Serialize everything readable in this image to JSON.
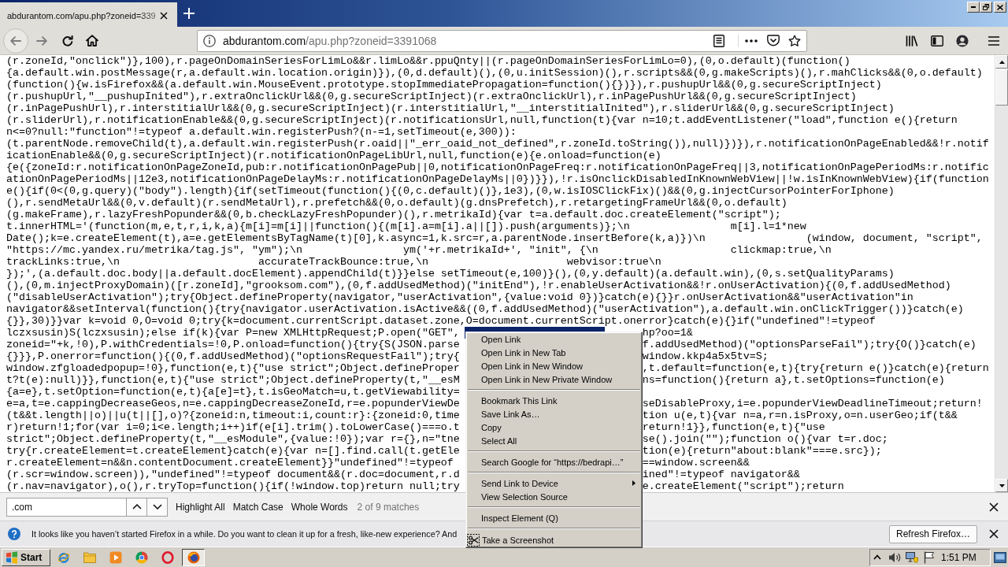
{
  "tab": {
    "title": "abdurantom.com/apu.php?zoneid=339",
    "selected": true
  },
  "back_button": {
    "disabled": true
  },
  "forward_button": {
    "disabled": true
  },
  "address_bar": {
    "domain": "abdurantom.com",
    "path": "/apu.php?zoneid=3391068"
  },
  "code_lines": [
    {
      "text": "(r.zoneId,\"onclick\")},100),r.pageOnDomainSeriesForLimLo&&r.limLo&&r.ppuQnty||(r.pageOnDomainSeriesForLimLo=0),(0,o.default)(function()"
    },
    {
      "text": "{a.default.win.postMessage(r,a.default.win.location.origin)}),(0,d.default)(),(0,u.initSession)(),r.scripts&&(0,g.makeScripts)(),r.mahClicks&&(0,o.default)"
    },
    {
      "text": "(function(){w.isFirefox&&(a.default.win.MouseEvent.prototype.stopImmediatePropagation=function(){})}),r.pushupUrl&&(0,g.secureScriptInject)"
    },
    {
      "text": "(r.pushupUrl,\"__pushupInited\"),r.extraOnclickUrl&&(0,g.secureScriptInject)(r.extraOnclickUrl),r.inPagePushUrl&&(0,g.secureScriptInject)"
    },
    {
      "text": "(r.inPagePushUrl),r.interstitialUrl&&(0,g.secureScriptInject)(r.interstitialUrl,\"__interstitialInited\"),r.sliderUrl&&(0,g.secureScriptInject)"
    },
    {
      "text": "(r.sliderUrl),r.notificationEnable&&(0,g.secureScriptInject)(r.notificationsUrl,null,function(t){var n=10;t.addEventListener(\"load\",function e(){return"
    },
    {
      "text": "n<=0?null:\"function\"!=typeof a.default.win.registerPush?(n-=1,setTimeout(e,300)):"
    },
    {
      "text": "(t.parentNode.removeChild(t),a.default.win.registerPush(r.oaid||\"_err_oaid_not_defined\",r.zoneId.toString()),null)})}),r.notificationOnPageEnabled&&!r.notif"
    },
    {
      "text": "icationEnable&&(0,g.secureScriptInject)(r.notificationOnPageLibUrl,null,function(e){e.onload=function(e)"
    },
    {
      "text": "{e({zoneId:r.notificationOnPageZoneId,pub:r.notificationOnPagePub||0,notificationOnPageFreq:r.notificationOnPageFreq||3,notificationOnPagePeriodMs:r.notific"
    },
    {
      "text": "ationOnPagePeriodMs||12e3,notificationOnPageDelayMs:r.notificationOnPageDelayMs||0})}}),!r.isOnclickDisabledInKnownWebView||!w.isInKnownWebView){if(function"
    },
    {
      "text": "e(){if(0<(0,g.query)(\"body\").length){if(setTimeout(function(){(0,c.default)()},1e3),(0,w.isIOSClickFix)()&&(0,g.injectCursorPointerForIphone)"
    },
    {
      "text": "(),r.sendMetaUrl&&(0,v.default)(r.sendMetaUrl),r.prefetch&&(0,o.default)(g.dnsPrefetch),r.retargetingFrameUrl&&(0,o.default)"
    },
    {
      "text": "(g.makeFrame),r.lazyFreshPopunder&&(0,b.checkLazyFreshPopunder)(),r.metrikaId){var t=a.default.doc.createElement(\"script\");"
    },
    {
      "text": "t.innerHTML='(function(m,e,t,r,i,k,a){m[i]=m[i]||function(){(m[i].a=m[i].a||[]).push(arguments)};\\n                m[i].l=1*new"
    },
    {
      "text": "Date();k=e.createElement(t),a=e.getElementsByTagName(t)[0],k.async=1,k.src=r,a.parentNode.insertBefore(k,a)})\\n                (window, document, \"script\","
    },
    {
      "text": "\"https://mc.yandex.ru/metrika/tag.js\", \"ym\");\\n                ym('+r.metrikaId+', \"init\", {\\n                     clickmap:true,\\n"
    },
    {
      "text": "trackLinks:true,\\n                      accurateTrackBounce:true,\\n                      webvisor:true\\n"
    },
    {
      "text": "});',(a.default.doc.body||a.default.docElement).appendChild(t)}}else setTimeout(e,100)}(),(0,y.default)(a.default.win),(0,s.setQualityParams)"
    },
    {
      "text": "(),(0,m.injectProxyDomain)([r.zoneId],\"grooksom.com\"),(0,f.addUsedMethod)(\"initEnd\"),!r.enableUserActivation&&!r.onUserActivation){(0,f.addUsedMethod)"
    },
    {
      "text": "(\"disableUserActivation\");try{Object.defineProperty(navigator,\"userActivation\",{value:void 0})}catch(e){}}r.onUserActivation&&\"userActivation\"in"
    },
    {
      "text": "navigator&&setInterval(function(){try{navigator.userActivation.isActive&&((0,f.addUsedMethod)(\"userActivation\"),a.default.win.onClickTrigger())}catch(e)"
    },
    {
      "text": "{}},30)}}var k=void 0,O=void 0;try{k=document.currentScript.dataset.zone,O=document.currentScript.onerror}catch(e){}if(\"undefined\"!=typeof"
    },
    {
      "left": "lczxsusin)S(lczxsusin);else if(k){var P=new XMLHttpRequest;P.open(\"GET\",",
      "right": "hp?oo=1&",
      "selected": true
    },
    {
      "left": "zoneid=\"+k,!0),P.withCredentials=!0,P.onload=function(){try{S(JSON.parse",
      "right": "f.addUsedMethod)(\"optionsParseFail\");try{O()}catch(e)"
    },
    {
      "left": "{}}},P.onerror=function(){(0,f.addUsedMethod)(\"optionsRequestFail\");try{",
      "right": "window.kkp4a5x5tv=S;"
    },
    {
      "left": "window.zfgloadedpopup=!0},function(e,t){\"use strict\";Object.defineProper",
      "right": ",t.default=function(e,t){try{return e()}catch(e){return"
    },
    {
      "left": "t?t(e):null)}},function(e,t){\"use strict\";Object.defineProperty(t,\"__esM",
      "right": "ns=function(){return a},t.setOptions=function(e)"
    },
    {
      "left": "{a=e},t.setOption=function(e,t){a[e]=t},t.isGeoMatch=u,t.getViewability="
    },
    {
      "left": "e=a,t=e.cappingDecreaseGeos,n=e.cappingDecreaseZoneId,r=e.popunderViewDe",
      "right": "seDisableProxy,i=e.popunderViewDeadlineTimeout;return!"
    },
    {
      "left": "(t&&t.length||o)||u(t||[],o)?{zoneid:n,timeout:i,count:r}:{zoneid:0,time",
      "right": "tion u(e,t){var n=a,r=n.isProxy,o=n.userGeo;if(t&&"
    },
    {
      "left": "r)return!1;for(var i=0;i<e.length;i++)if(e[i].trim().toLowerCase()===o.t",
      "right": "return!1}},function(e,t){\"use"
    },
    {
      "left": "strict\";Object.defineProperty(t,\"__esModule\",{value:!0});var r={},n=\"tne",
      "right": "se().join(\"\");function o(){var t=r.doc;"
    },
    {
      "left": "try{r.createElement=t.createElement}catch(e){var n=[].find.call(t.getEle",
      "right": "tion(e){return\"about:blank\"===e.src});"
    },
    {
      "left": "r.createElement=n&&n.contentDocument.createElement}}\"undefined\"!=typeof",
      "right": "==window.screen&&"
    },
    {
      "left": "(r.scr=window.screen)),\"undefined\"!=typeof document&&(r.doc=document,r.d",
      "right": "ined\"!=typeof navigator&&"
    },
    {
      "left": "(r.nav=navigator),o(),r.tryTop=function(){if(!window.top)return null;try",
      "right": "e.createElement(\"script\");return"
    }
  ],
  "find_bar": {
    "query": ".com",
    "options": [
      "Highlight All",
      "Match Case",
      "Whole Words"
    ],
    "status": "2 of 9 matches"
  },
  "notification": {
    "message": "It looks like you haven’t started Firefox in a while. Do you want to clean it up for a fresh, like-new experience? And",
    "button": "Refresh Firefox…"
  },
  "taskbar": {
    "start": "Start",
    "apps": [
      {
        "kind": "orbit",
        "selected": false
      },
      {
        "kind": "folder",
        "selected": false
      },
      {
        "kind": "play",
        "selected": false
      },
      {
        "kind": "segments",
        "selected": false
      },
      {
        "kind": "ring",
        "selected": false
      },
      {
        "kind": "globe",
        "selected": true
      }
    ],
    "clock": "1:51 PM"
  },
  "context_menu": {
    "items": [
      {
        "kind": "item",
        "label": "Open Link"
      },
      {
        "kind": "item",
        "label": "Open Link in New Tab"
      },
      {
        "kind": "item",
        "label": "Open Link in New Window"
      },
      {
        "kind": "item",
        "label": "Open Link in New Private Window"
      },
      {
        "kind": "separator"
      },
      {
        "kind": "item",
        "label": "Bookmark This Link"
      },
      {
        "kind": "item",
        "label": "Save Link As…"
      },
      {
        "kind": "item",
        "label": "Copy"
      },
      {
        "kind": "item",
        "label": "Select All"
      },
      {
        "kind": "separator"
      },
      {
        "kind": "item",
        "label": "Search Google for “https://bedrapi…”"
      },
      {
        "kind": "separator"
      },
      {
        "kind": "submenu",
        "label": "Send Link to Device"
      },
      {
        "kind": "item",
        "label": "View Selection Source"
      },
      {
        "kind": "separator"
      },
      {
        "kind": "item",
        "label": "Inspect Element (Q)"
      },
      {
        "kind": "separator"
      },
      {
        "kind": "tool",
        "label": "Take a Screenshot"
      }
    ]
  }
}
